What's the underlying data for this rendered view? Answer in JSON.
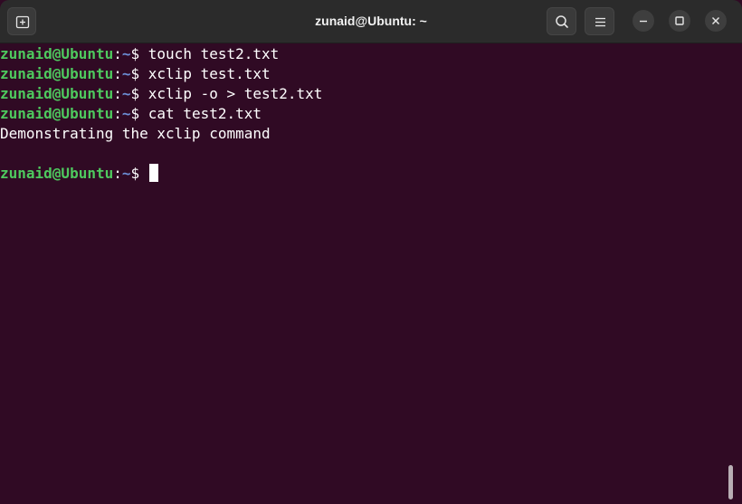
{
  "window": {
    "title": "zunaid@Ubuntu: ~"
  },
  "terminal": {
    "lines": [
      {
        "type": "prompt",
        "user": "zunaid@Ubuntu",
        "path": "~",
        "dollar": "$ ",
        "command": "touch test2.txt"
      },
      {
        "type": "prompt",
        "user": "zunaid@Ubuntu",
        "path": "~",
        "dollar": "$ ",
        "command": "xclip test.txt"
      },
      {
        "type": "prompt",
        "user": "zunaid@Ubuntu",
        "path": "~",
        "dollar": "$ ",
        "command": "xclip -o > test2.txt"
      },
      {
        "type": "prompt",
        "user": "zunaid@Ubuntu",
        "path": "~",
        "dollar": "$ ",
        "command": "cat test2.txt"
      },
      {
        "type": "output",
        "text": "Demonstrating the xclip command"
      },
      {
        "type": "output",
        "text": ""
      },
      {
        "type": "prompt",
        "user": "zunaid@Ubuntu",
        "path": "~",
        "dollar": "$ ",
        "command": ""
      }
    ]
  },
  "icons": {
    "new_tab": "new-tab-icon",
    "search": "search-icon",
    "menu": "hamburger-menu-icon",
    "minimize": "minimize-icon",
    "maximize": "maximize-icon",
    "close": "close-icon"
  },
  "colors": {
    "background": "#300a24",
    "titlebar": "#2b2b2b",
    "prompt_user": "#4ec95e",
    "prompt_path": "#6c8fd6",
    "text": "#ffffff"
  }
}
